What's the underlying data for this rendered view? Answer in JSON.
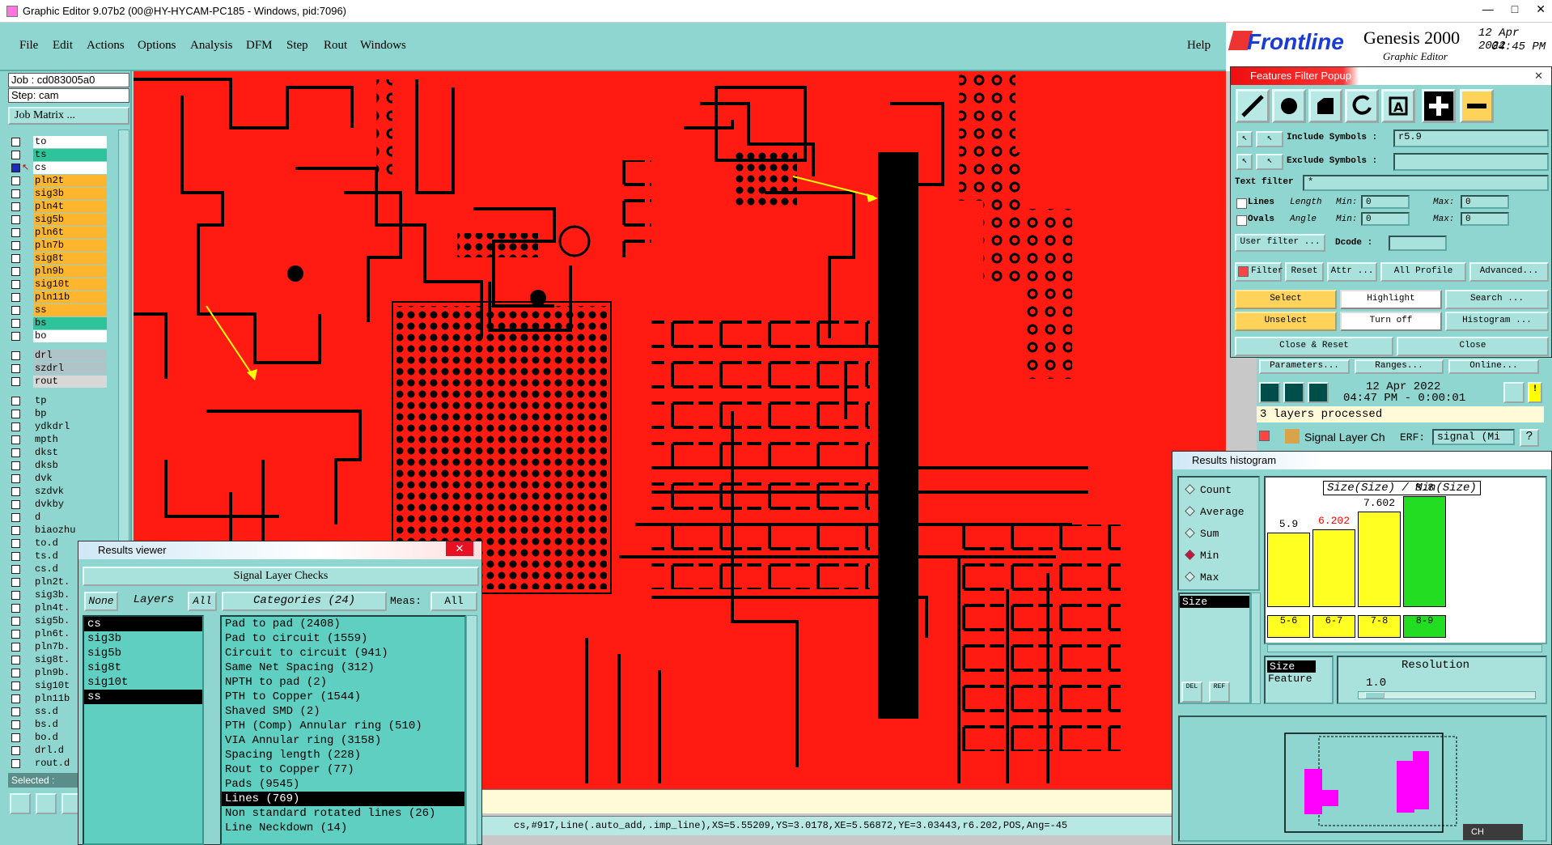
{
  "window": {
    "title": "Graphic Editor 9.07b2 (00@HY-HYCAM-PC185 - Windows, pid:7096)"
  },
  "menu": {
    "items": [
      "File",
      "Edit",
      "Actions",
      "Options",
      "Analysis",
      "DFM",
      "Step",
      "Rout",
      "Windows"
    ],
    "help": "Help"
  },
  "brand": {
    "logo": "Frontline",
    "product": "Genesis 2000",
    "subtitle": "Graphic Editor",
    "date": "12 Apr 2022",
    "time": "04:45 PM"
  },
  "job": {
    "job_label": "Job : cd083005a0",
    "step_label": "Step: cam",
    "matrix_button": "Job Matrix ..."
  },
  "layers": [
    {
      "name": "to",
      "color": "#ffffff",
      "edit": true
    },
    {
      "name": "ts",
      "color": "#2ec39a",
      "edit": false
    },
    {
      "name": "cs",
      "color": "#ffffff",
      "edit": true,
      "active": true
    },
    {
      "name": "pln2t",
      "color": "#ffb62e",
      "edit": true
    },
    {
      "name": "sig3b",
      "color": "#ffb62e",
      "edit": true
    },
    {
      "name": "pln4t",
      "color": "#ffb62e",
      "edit": true
    },
    {
      "name": "sig5b",
      "color": "#ffb62e",
      "edit": true
    },
    {
      "name": "pln6t",
      "color": "#ffb62e",
      "edit": true
    },
    {
      "name": "pln7b",
      "color": "#ffb62e",
      "edit": true
    },
    {
      "name": "sig8t",
      "color": "#ffb62e",
      "edit": true
    },
    {
      "name": "pln9b",
      "color": "#ffb62e",
      "edit": true
    },
    {
      "name": "sig10t",
      "color": "#ffb62e",
      "edit": false
    },
    {
      "name": "pln11b",
      "color": "#ffb62e",
      "edit": true
    },
    {
      "name": "ss",
      "color": "#ffb62e",
      "edit": false
    },
    {
      "name": "bs",
      "color": "#2ec39a",
      "edit": false
    },
    {
      "name": "bo",
      "color": "#ffffff",
      "edit": false
    }
  ],
  "drill_layers": [
    "drl",
    "szdrl",
    "rout"
  ],
  "misc_layers": [
    "tp",
    "bp",
    "ydkdrl",
    "mpth",
    "dkst",
    "dksb",
    "dvk",
    "szdvk",
    "dvkby",
    "d",
    "biaozhu",
    "to.d",
    "ts.d",
    "cs.d",
    "pln2t.",
    "sig3b.",
    "pln4t.",
    "sig5b.",
    "pln6t.",
    "pln7b.",
    "sig8t.",
    "pln9b.",
    "sig10t",
    "pln11b",
    "ss.d",
    "bs.d",
    "bo.d",
    "drl.d",
    "rout.d"
  ],
  "selected_label": "Selected :",
  "filter_popup": {
    "title": "Features Filter Popup",
    "include_label": "Include Symbols :",
    "include_value": "r5.9",
    "exclude_label": "Exclude Symbols :",
    "exclude_value": "",
    "text_filter_label": "Text filter",
    "text_filter_value": "*",
    "lines_label": "Lines",
    "ovals_label": "Ovals",
    "length_label": "Length",
    "angle_label": "Angle",
    "min_label": "Min:",
    "max_label": "Max:",
    "min_value": "0",
    "max_value": "0",
    "user_filter": "User filter ...",
    "dcode_label": "Dcode :",
    "filter_toggle": "Filter",
    "reset": "Reset",
    "attr": "Attr ...",
    "all_profile": "All Profile",
    "advanced": "Advanced...",
    "select": "Select",
    "highlight": "Highlight",
    "search": "Search ...",
    "unselect": "Unselect",
    "turn_off": "Turn off",
    "histogram": "Histogram ...",
    "close_reset": "Close & Reset",
    "close": "Close"
  },
  "checks": {
    "parameters": "Parameters...",
    "ranges": "Ranges...",
    "online": "Online...",
    "date": "12 Apr 2022",
    "time": "04:47 PM - 0:00:01",
    "processed": "3 layers processed",
    "check_name": "Signal Layer Ch",
    "erf_label": "ERF:",
    "erf_value": "signal (Mi"
  },
  "histogram": {
    "title": "Results histogram",
    "modes": [
      "Count",
      "Average",
      "Sum",
      "Min",
      "Max"
    ],
    "selected_mode": "Min",
    "list_item": "Size",
    "chart_title": "Size(Size) / Min(Size)",
    "size_label": "Size",
    "feature_label": "Feature",
    "resolution_label": "Resolution",
    "resolution_value": "1.0",
    "del_label": "DEL",
    "ref_label": "REF"
  },
  "chart_data": {
    "type": "bar",
    "title": "Size(Size) / Min(Size)",
    "categories": [
      "5-6",
      "6-7",
      "7-8",
      "8-9"
    ],
    "values": [
      5.9,
      6.202,
      7.602,
      8.8
    ],
    "value_labels": [
      "5.9",
      "6.202",
      "7.602",
      "8.8"
    ],
    "bar_colors": [
      "#ffff22",
      "#ffff22",
      "#ffff22",
      "#22dd22"
    ],
    "label_colors": [
      "#000000",
      "#ff0000",
      "#000000",
      "#000000"
    ],
    "ylim": [
      0,
      9
    ]
  },
  "results_viewer": {
    "title": "Results viewer",
    "heading": "Signal Layer Checks",
    "none_button": "None",
    "layers_label": "Layers",
    "all_button": "All",
    "categories_label": "Categories (24)",
    "meas_label": "Meas:",
    "meas_value": "All",
    "layers": [
      {
        "name": "cs",
        "selected": true
      },
      {
        "name": "sig3b",
        "selected": false
      },
      {
        "name": "sig5b",
        "selected": false
      },
      {
        "name": "sig8t",
        "selected": false
      },
      {
        "name": "sig10t",
        "selected": false
      },
      {
        "name": "ss",
        "selected": true
      }
    ],
    "categories": [
      {
        "name": "Pad to pad (2408)",
        "selected": false
      },
      {
        "name": "Pad to circuit (1559)",
        "selected": false
      },
      {
        "name": "Circuit to circuit (941)",
        "selected": false
      },
      {
        "name": "Same Net Spacing (312)",
        "selected": false
      },
      {
        "name": "NPTH to pad (2)",
        "selected": false
      },
      {
        "name": "PTH to Copper (1544)",
        "selected": false
      },
      {
        "name": "Shaved SMD (2)",
        "selected": false
      },
      {
        "name": "PTH (Comp) Annular ring (510)",
        "selected": false
      },
      {
        "name": "VIA Annular ring (3158)",
        "selected": false
      },
      {
        "name": "Spacing length (228)",
        "selected": false
      },
      {
        "name": "Rout to Copper (77)",
        "selected": false
      },
      {
        "name": "Pads (9545)",
        "selected": false
      },
      {
        "name": "Lines (769)",
        "selected": true
      },
      {
        "name": "Non standard rotated lines (26)",
        "selected": false
      },
      {
        "name": "Line Neckdown (14)",
        "selected": false
      }
    ]
  },
  "status": {
    "coord_text": "cs,#917,Line(.auto_add,.imp_line),XS=5.55209,YS=3.0178,XE=5.56872,YE=3.03443,r6.202,POS,Ang=-45"
  },
  "taskbar": {
    "ime": "CH"
  }
}
